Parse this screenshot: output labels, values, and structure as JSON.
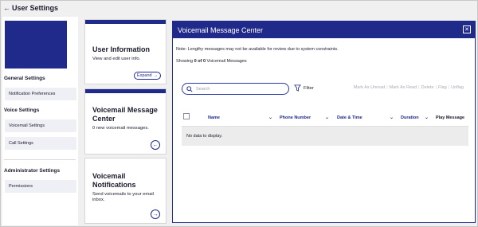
{
  "header": {
    "back_icon": "arrow-left-icon",
    "title": "User Settings"
  },
  "sidebar": {
    "sections": [
      {
        "title": "General Settings",
        "items": [
          "Notification Preferences"
        ]
      },
      {
        "title": "Voice Settings",
        "items": [
          "Voicemail Settings",
          "Call Settings"
        ]
      },
      {
        "title": "Administrator Settings",
        "items": [
          "Permissions"
        ]
      }
    ],
    "banner_color": "#1f2a8a"
  },
  "cards": [
    {
      "title": "User Information",
      "description": "View and edit user info.",
      "button_label": "Expand",
      "button_icon": "arrow-right-icon"
    },
    {
      "title": "Voicemail Message Center",
      "description": "0 new voicemail messages.",
      "button_icon": "arrow-left-circle-icon"
    },
    {
      "title": "Voicemail Notifications",
      "description": "Send voicemails to your email inbox.",
      "button_icon": "arrow-right-circle-icon"
    }
  ],
  "panel": {
    "title": "Voicemail Message Center",
    "close_icon": "close-icon",
    "note": "Note: Lengthy messages may not be available for review due to system constraints.",
    "showing_prefix": "Showing ",
    "showing_range": "0 of 0",
    "showing_suffix": " Voicemail Messages",
    "search_placeholder": "Search",
    "filter_label": "Filter",
    "actions": [
      "Mark As Unread",
      "Mark As Read",
      "Delete",
      "Flag",
      "Unflag"
    ],
    "columns": [
      "Name",
      "Phone Number",
      "Date & Time",
      "Duration",
      "Play Message"
    ],
    "empty_text": "No data to display."
  },
  "colors": {
    "brand": "#1f2a8a",
    "background": "#f0f0f0",
    "row_empty": "#ececec"
  }
}
